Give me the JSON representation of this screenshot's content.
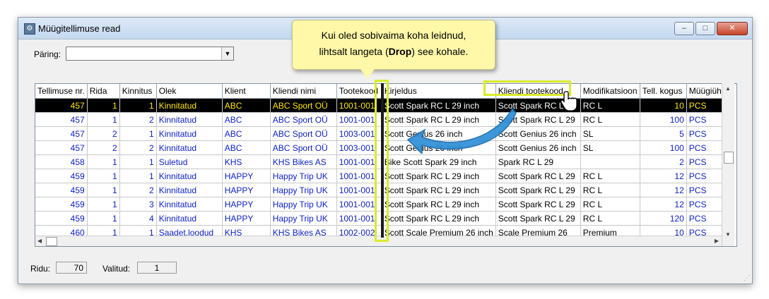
{
  "window": {
    "title": "Müügitellimuse read",
    "buttons": [
      "–",
      "□",
      "✕"
    ]
  },
  "query": {
    "label": "Päring:",
    "value": ""
  },
  "grid": {
    "columns": [
      "Tellimuse nr.",
      "Rida",
      "Kinnitus",
      "Olek",
      "Klient",
      "Kliendi nimi",
      "Tootekood",
      "Kirjeldus",
      "Kliendi tootekood",
      "Modifikatsioon",
      "Tell. kogus",
      "Müügiühik"
    ],
    "rows": [
      [
        "457",
        "1",
        "1",
        "Kinnitatud",
        "ABC",
        "ABC Sport OÜ",
        "1001-001",
        "Scott Spark RC L 29 inch",
        "Scott Spark RC L 29",
        "RC L",
        "10",
        "PCS"
      ],
      [
        "457",
        "1",
        "2",
        "Kinnitatud",
        "ABC",
        "ABC Sport OÜ",
        "1001-001",
        "Scott Spark RC L 29 inch",
        "Scott Spark RC L 29",
        "RC L",
        "100",
        "PCS"
      ],
      [
        "457",
        "2",
        "1",
        "Kinnitatud",
        "ABC",
        "ABC Sport OÜ",
        "1003-001",
        "Scott Genius 26 inch",
        "Scott Genius 26 inch",
        "SL",
        "5",
        "PCS"
      ],
      [
        "457",
        "2",
        "2",
        "Kinnitatud",
        "ABC",
        "ABC Sport OÜ",
        "1003-001",
        "Scott Genius 26 inch",
        "Scott Genius 26 inch",
        "SL",
        "100",
        "PCS"
      ],
      [
        "458",
        "1",
        "1",
        "Suletud",
        "KHS",
        "KHS Bikes AS",
        "1001-001",
        "Bike Scott Spark 29 inch",
        "Spark RC L 29",
        "",
        "2",
        "PCS"
      ],
      [
        "459",
        "1",
        "1",
        "Kinnitatud",
        "HAPPY",
        "Happy Trip UK",
        "1001-001",
        "Scott Spark RC L 29 inch",
        "Scott Spark RC L 29",
        "RC L",
        "12",
        "PCS"
      ],
      [
        "459",
        "1",
        "2",
        "Kinnitatud",
        "HAPPY",
        "Happy Trip UK",
        "1001-001",
        "Scott Spark RC L 29 inch",
        "Scott Spark RC L 29",
        "RC L",
        "12",
        "PCS"
      ],
      [
        "459",
        "1",
        "3",
        "Kinnitatud",
        "HAPPY",
        "Happy Trip UK",
        "1001-001",
        "Scott Spark RC L 29 inch",
        "Scott Spark RC L 29",
        "RC L",
        "12",
        "PCS"
      ],
      [
        "459",
        "1",
        "4",
        "Kinnitatud",
        "HAPPY",
        "Happy Trip UK",
        "1001-001",
        "Scott Spark RC L 29 inch",
        "Scott Spark RC L 29",
        "RC L",
        "120",
        "PCS"
      ],
      [
        "460",
        "1",
        "1",
        "Saadet.loodud",
        "KHS",
        "KHS Bikes AS",
        "1002-002",
        "Scott Scale Premium 26 inch",
        "Scale Premium 26",
        "Premium",
        "10",
        "PCS"
      ]
    ]
  },
  "status": {
    "rows_label": "Ridu:",
    "rows_value": "70",
    "selected_label": "Valitud:",
    "selected_value": "1"
  },
  "callout": {
    "line1": "Kui oled sobivaima koha leidnud,",
    "line2_pre": "lihtsalt langeta (",
    "line2_bold": "Drop",
    "line2_post": ") see kohale."
  },
  "colors": {
    "row_text": "#0b1fc4",
    "selected_bg": "#000000",
    "selected_text": "#ffe600",
    "highlight": "#d9ec2a",
    "callout_bg": "#fff8a8",
    "arrow": "#2d8fd6"
  }
}
